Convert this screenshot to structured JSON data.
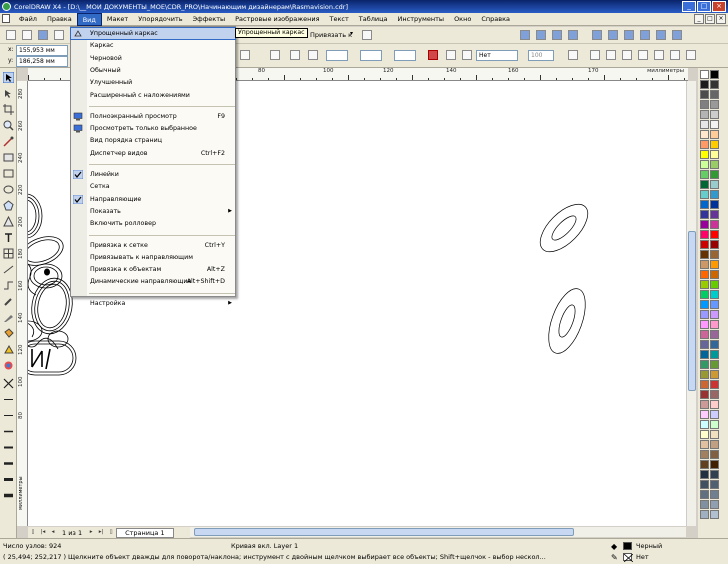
{
  "window": {
    "title": "CorelDRAW X4 - [D:\\__МОИ ДОКУМЕНТЫ_МОЕ\\CDR_PRO\\Начинающим дизайнерам\\Rasmavision.cdr]",
    "min": "_",
    "max": "□",
    "close": "×"
  },
  "menu": {
    "items": [
      "Файл",
      "Правка",
      "Вид",
      "Макет",
      "Упорядочить",
      "Эффекты",
      "Растровые изображения",
      "Текст",
      "Таблица",
      "Инструменты",
      "Окно",
      "Справка"
    ],
    "active_index": 2
  },
  "toolbar": {
    "x_label": "x:",
    "x_value": "155,953 мм",
    "y_label": "y:",
    "y_value": "186,258 мм",
    "snap_label": "Привязать к",
    "outline_value": "Нет",
    "percent_value": "100"
  },
  "dropdown": {
    "rows": [
      {
        "label": "Упрощенный каркас",
        "shortcut": "",
        "check": "wire",
        "highlight": true
      },
      {
        "label": "Каркас",
        "shortcut": ""
      },
      {
        "label": "Черновой",
        "shortcut": ""
      },
      {
        "label": "Обычный",
        "shortcut": ""
      },
      {
        "label": "Улучшенный",
        "shortcut": ""
      },
      {
        "label": "Расширенный с наложениями",
        "shortcut": ""
      },
      {
        "sep": true
      },
      {
        "label": "Полноэкранный просмотр",
        "shortcut": "F9",
        "check": "monitor"
      },
      {
        "label": "Просмотреть только выбранное",
        "shortcut": "",
        "check": "monitor"
      },
      {
        "label": "Вид порядка страниц",
        "shortcut": ""
      },
      {
        "label": "Диспетчер видов",
        "shortcut": "Ctrl+F2"
      },
      {
        "sep": true
      },
      {
        "label": "Линейки",
        "shortcut": "",
        "check": "tick"
      },
      {
        "label": "Сетка",
        "shortcut": ""
      },
      {
        "label": "Направляющие",
        "shortcut": "",
        "check": "tick"
      },
      {
        "label": "Показать",
        "shortcut": "",
        "submenu": true
      },
      {
        "label": "Включить ролловер",
        "shortcut": ""
      },
      {
        "sep": true
      },
      {
        "label": "Привязка к сетке",
        "shortcut": "Ctrl+Y"
      },
      {
        "label": "Привязывать к направляющим",
        "shortcut": ""
      },
      {
        "label": "Привязка к объектам",
        "shortcut": "Alt+Z"
      },
      {
        "label": "Динамические направляющие",
        "shortcut": "Alt+Shift+D"
      },
      {
        "sep": true
      },
      {
        "label": "Настройка",
        "shortcut": "",
        "submenu": true
      }
    ],
    "tooltip": "Упрощенный каркас"
  },
  "ruler": {
    "h_labels": [
      "60",
      "80",
      "100",
      "120",
      "140",
      "160",
      "170"
    ],
    "h_unit": "миллиметры",
    "v_labels": [
      "280",
      "260",
      "240",
      "220",
      "200",
      "180",
      "160",
      "140",
      "120",
      "100",
      "80"
    ],
    "v_unit": "миллиметры"
  },
  "pagenav": {
    "count": "1 из 1",
    "page_tab": "Страница 1"
  },
  "status": {
    "nodes": "Число узлов: 924",
    "object_info": "Кривая вкл. Layer 1",
    "coords": "( 25,494; 252,217 )",
    "hint": "Щелкните объект дважды для поворота/наклона; инструмент с двойным щелчком выбирает все объекты; Shift+щелчок - выбор нескол...",
    "fill_name": "Черный",
    "outline_name": "Нет"
  },
  "palette_colors": [
    "#ffffff",
    "#000000",
    "#1a1a1a",
    "#333333",
    "#4d4d4d",
    "#666666",
    "#808080",
    "#999999",
    "#b3b3b3",
    "#cccccc",
    "#e6e6e6",
    "#f2f2f2",
    "#ffe6cc",
    "#ffcc99",
    "#ff9966",
    "#ffcc00",
    "#ffff00",
    "#ffff99",
    "#ccff99",
    "#99cc66",
    "#66cc66",
    "#339933",
    "#006633",
    "#99cccc",
    "#66cccc",
    "#3399cc",
    "#0066cc",
    "#003399",
    "#333399",
    "#663399",
    "#990099",
    "#cc3399",
    "#ff0066",
    "#ff0000",
    "#cc0000",
    "#990000",
    "#663300",
    "#996633",
    "#cc9966",
    "#ff9900",
    "#ff6600",
    "#cc6600",
    "#99cc00",
    "#66cc00",
    "#00cc66",
    "#00cccc",
    "#0099ff",
    "#6699ff",
    "#9999ff",
    "#cc99ff",
    "#ff99ff",
    "#ff99cc",
    "#cc6699",
    "#996699",
    "#666699",
    "#336699",
    "#006699",
    "#009999",
    "#339966",
    "#669933",
    "#999933",
    "#cc9933",
    "#cc6633",
    "#cc3333",
    "#993333",
    "#996666",
    "#cc9999",
    "#ffcccc",
    "#ffccff",
    "#ccccff",
    "#ccffff",
    "#ccffcc",
    "#ffffcc",
    "#f0e0c0",
    "#e0c0a0",
    "#c0a080",
    "#a08060",
    "#806040",
    "#604020",
    "#402000",
    "#203040",
    "#304050",
    "#405060",
    "#506070",
    "#607080",
    "#708090",
    "#8090a0",
    "#90a0b0",
    "#a0b0c0",
    "#b0c0d0"
  ]
}
